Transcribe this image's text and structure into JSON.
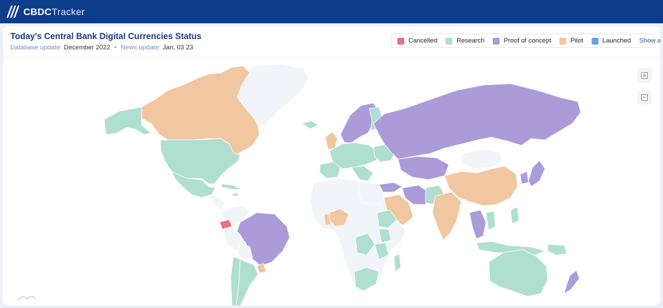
{
  "app": {
    "logo_bold": "CBDC",
    "logo_light": "Tracker",
    "logo_icon": "slashes-logo-icon"
  },
  "card": {
    "title": "Today's Central Bank Digital Currencies Status",
    "db_label": "Database update:",
    "db_value": "December 2022",
    "separator": "•",
    "news_label": "News update:",
    "news_value": "Jan, 03 23"
  },
  "legend": {
    "items": [
      {
        "label": "Cancelled",
        "color": "#ea6f80"
      },
      {
        "label": "Research",
        "color": "#afdfcf"
      },
      {
        "label": "Proof of concept",
        "color": "#ab9bd9"
      },
      {
        "label": "Pilot",
        "color": "#f1c7a1"
      },
      {
        "label": "Launched",
        "color": "#6a9fe2"
      }
    ],
    "show_all": "Show all"
  },
  "map": {
    "land_default_color": "#f1f4f9",
    "border_color": "#ffffff"
  },
  "controls": {
    "zoom_in_icon": "zoom-in-icon",
    "zoom_out_icon": "zoom-out-icon"
  }
}
